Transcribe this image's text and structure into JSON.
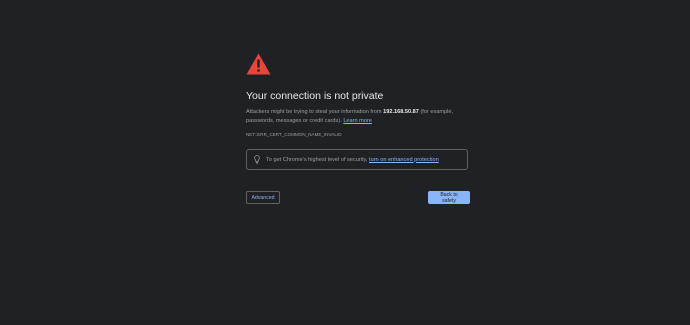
{
  "interstitial": {
    "title": "Your connection is not private",
    "description_prefix": "Attackers might be trying to steal your information from ",
    "host": "192.168.50.87",
    "description_suffix": " (for example, passwords, messages or credit cards). ",
    "learn_more_label": "Learn more",
    "error_code": "NET::ERR_CERT_COMMON_NAME_INVALID",
    "protection_prefix": "To get Chrome’s highest level of security, ",
    "protection_link_label": "turn on enhanced protection",
    "advanced_label": "Advanced",
    "back_label": "Back to safety"
  },
  "colors": {
    "background": "#202124",
    "warning": "#e8453c",
    "link": "#8ab4f8",
    "primary_button": "#8ab4f8"
  },
  "icons": {
    "warning": "warning-triangle-icon",
    "bulb": "lightbulb-icon"
  }
}
